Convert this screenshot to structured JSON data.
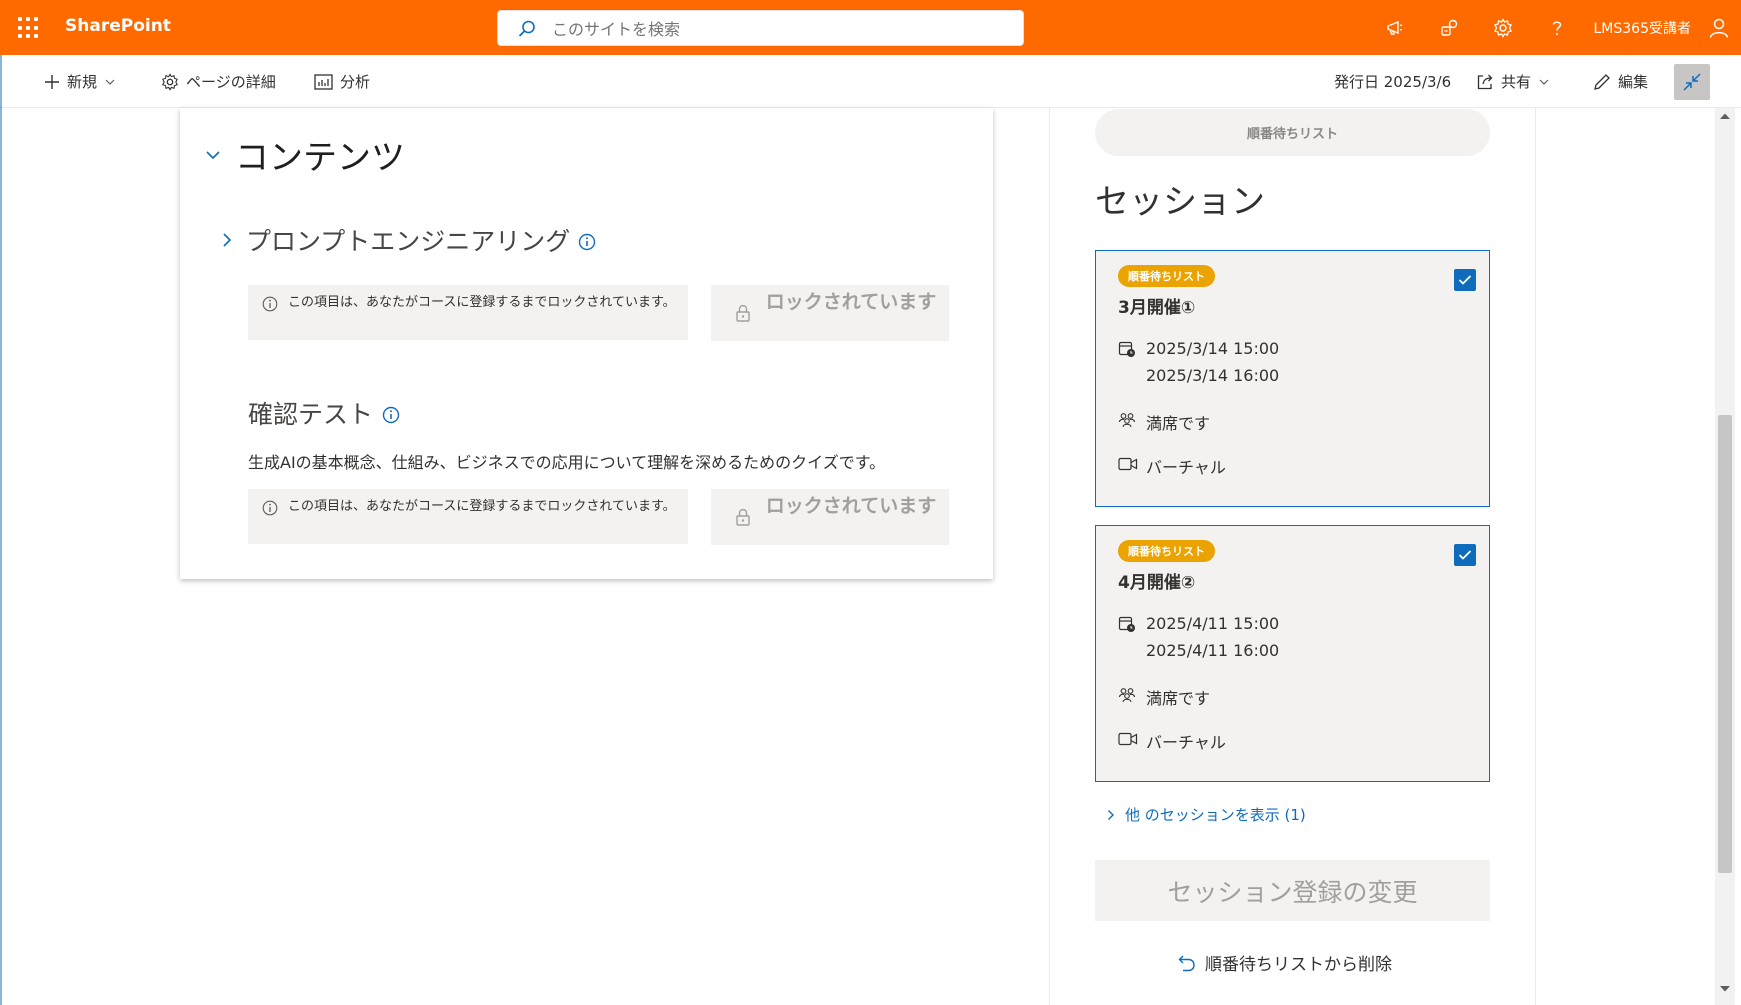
{
  "suitebar": {
    "app_name": "SharePoint",
    "search_placeholder": "このサイトを検索",
    "user_name": "LMS365受講者",
    "icons": [
      "app-launcher-icon",
      "megaphone-icon",
      "sharepoint-connect-icon",
      "gear-icon",
      "help-icon",
      "person-icon"
    ]
  },
  "commandbar": {
    "new_label": "新規",
    "page_details_label": "ページの詳細",
    "analytics_label": "分析",
    "published_label": "発行日 2025/3/6",
    "share_label": "共有",
    "edit_label": "編集"
  },
  "content": {
    "heading": "コンテンツ",
    "module_title": "プロンプトエンジニアリング",
    "notice_text": "この項目は、あなたがコースに登録するまでロックされています。",
    "locked_label": "ロックされています",
    "test_title": "確認テスト",
    "test_description": "生成AIの基本概念、仕組み、ビジネスでの応用について理解を深めるためのクイズです。"
  },
  "sidebar": {
    "waitlist_pill": "順番待ちリスト",
    "sessions_heading": "セッション",
    "sessions": [
      {
        "badge": "順番待ちリスト",
        "name": "3月開催①",
        "start": "2025/3/14 15:00",
        "end": "2025/3/14 16:00",
        "capacity": "満席です",
        "location": "バーチャル",
        "checked": true
      },
      {
        "badge": "順番待ちリスト",
        "name": "4月開催②",
        "start": "2025/4/11 15:00",
        "end": "2025/4/11 16:00",
        "capacity": "満席です",
        "location": "バーチャル",
        "checked": true
      }
    ],
    "more_sessions_link": "他 のセッションを表示 (1)",
    "change_button": "セッション登録の変更",
    "remove_link": "順番待ちリストから削除"
  },
  "colors": {
    "suite_bar": "#ff6a00",
    "accent": "#0f6cbd",
    "badge": "#eaa300"
  }
}
